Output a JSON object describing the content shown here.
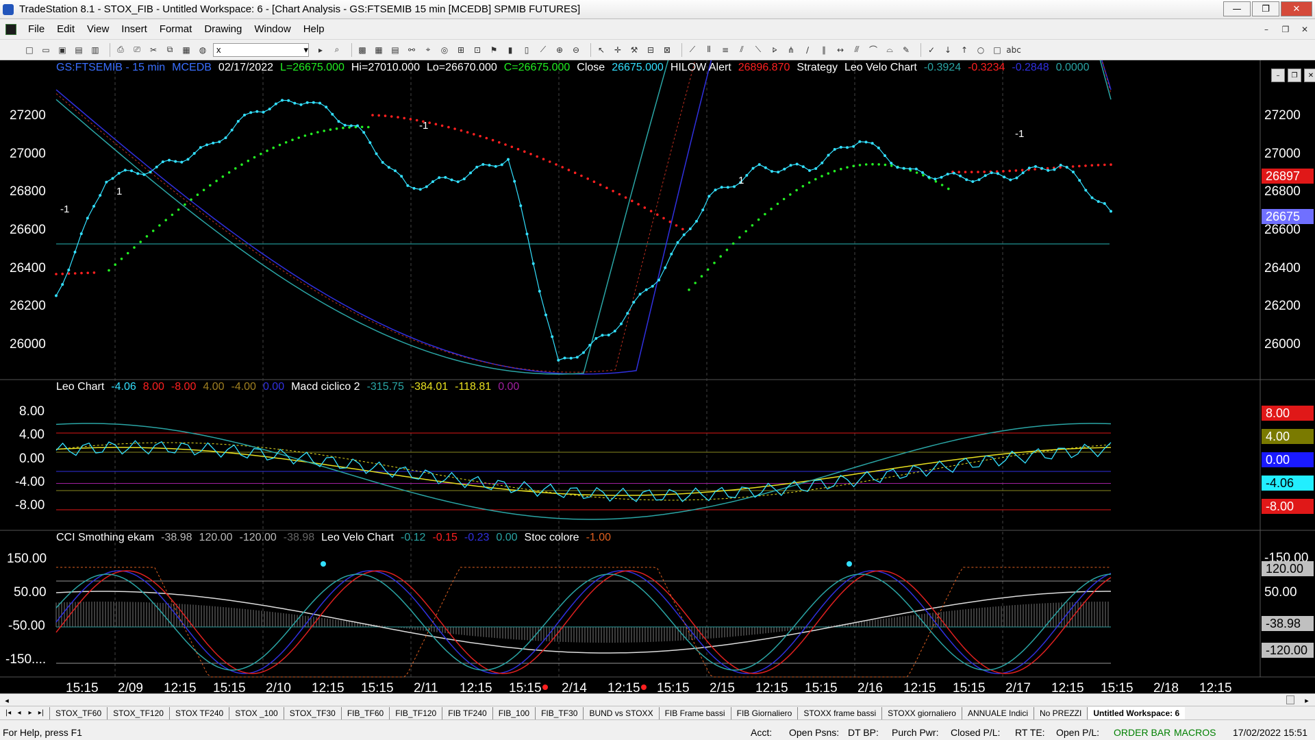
{
  "window": {
    "title": "TradeStation 8.1 - STOX_FIB - Untitled Workspace:  6 - [Chart Analysis - GS:FTSEMIB  15 min  [MCEDB] SPMIB FUTURES]",
    "minimize": "—",
    "maximize": "❐",
    "close": "✕"
  },
  "menu": [
    "File",
    "Edit",
    "View",
    "Insert",
    "Format",
    "Drawing",
    "Window",
    "Help"
  ],
  "toolbar": {
    "symbol_value": "x"
  },
  "panel_buttons": [
    "–",
    "❐",
    "✕"
  ],
  "header1": {
    "symbol": "GS:FTSEMIB - 15 min",
    "source": "MCEDB",
    "date": "02/17/2022",
    "low_label": "L=26675.000",
    "hi": "Hi=27010.000",
    "lo": "Lo=26670.000",
    "c": "C=26675.000",
    "close_label": "Close",
    "close_value": "26675.000",
    "hilow_label": "HILOW Alert",
    "hilow_value": "26896.870",
    "strategy": "Strategy",
    "velo_label": "Leo Velo Chart",
    "velo_values": [
      "-0.3924",
      "-0.3234",
      "-0.2848",
      "0.0000"
    ]
  },
  "header2": {
    "leo_label": "Leo Chart",
    "leo_values": [
      "-4.06",
      "8.00",
      "-8.00",
      "4.00",
      "-4.00",
      "0.00"
    ],
    "macd_label": "Macd ciclico 2",
    "macd_values": [
      "-315.75",
      "-384.01",
      "-118.81",
      "0.00"
    ]
  },
  "header3": {
    "cci_label": "CCI Smothing ekam",
    "cci_values": [
      "-38.98",
      "120.00",
      "-120.00",
      "-38.98"
    ],
    "velo_label": "Leo Velo Chart",
    "velo_values": [
      "-0.12",
      "-0.15",
      "-0.23",
      "0.00"
    ],
    "stoc_label": "Stoc colore",
    "stoc_value": "-1.00"
  },
  "yaxis_price": [
    "27200",
    "27000",
    "26800",
    "26600",
    "26400",
    "26200",
    "26000"
  ],
  "yaxis_leo": [
    "8.00",
    "4.00",
    "0.00",
    "-4.00",
    "-8.00"
  ],
  "yaxis_cci": [
    "150.00",
    "50.00",
    "-50.00",
    "-150...."
  ],
  "yaxis_right_price": [
    "27200",
    "27000",
    "26800",
    "26600",
    "26400",
    "26200",
    "26000"
  ],
  "yaxis_right_leo": [],
  "yaxis_right_cci": [
    "-150.00",
    "50.00"
  ],
  "price_tags": {
    "hilow": "26897",
    "last": "26675",
    "leo_red": "8.00",
    "leo_olive": "4.00",
    "leo_blue": "0.00",
    "leo_cyan": "-4.06",
    "leo_red2": "-8.00",
    "cci_120": "120.00",
    "cci_val": "-38.98",
    "cci_m120": "-120.00"
  },
  "signal_labels": [
    "-1",
    "1",
    "-1",
    "1",
    "-1"
  ],
  "xaxis": [
    "15:15",
    "2/09",
    "12:15",
    "15:15",
    "2/10",
    "12:15",
    "15:15",
    "2/11",
    "12:15",
    "15:15",
    "2/14",
    "12:15",
    "15:15",
    "2/15",
    "12:15",
    "15:15",
    "2/16",
    "12:15",
    "15:15",
    "2/17",
    "12:15",
    "15:15",
    "2/18",
    "12:15"
  ],
  "tabs": [
    "STOX_TF60",
    "STOX_TF120",
    "STOX TF240",
    "STOX _100",
    "STOX_TF30",
    "FIB_TF60",
    "FIB_TF120",
    "FIB TF240",
    "FIB_100",
    "FIB_TF30",
    "BUND vs STOXX",
    "FIB Frame bassi",
    "FIB Giornaliero",
    "STOXX frame bassi",
    "STOXX giornaliero",
    "ANNUALE Indici",
    "No PREZZI",
    "Untitled Workspace:  6"
  ],
  "status": {
    "help": "For Help, press F1",
    "acct": "Acct:",
    "open_psns": "Open Psns:",
    "dt_bp": "DT BP:",
    "purch_pwr": "Purch Pwr:",
    "closed_pl": "Closed P/L:",
    "rt_te": "RT TE:",
    "open_pl": "Open P/L:",
    "order_bar": "ORDER BAR",
    "macros": "MACROS",
    "datetime": "17/02/2022 15:51"
  },
  "colors": {
    "background": "#000000",
    "price": "#33e0ff",
    "hilow_red": "#ff2020",
    "hilow_green": "#22ee22",
    "ma_blue": "#3030e0",
    "ma_teal": "#2aa5a5",
    "ma_red_dotted": "#c03020",
    "macd_yellow": "#e8e020"
  },
  "chart_data": {
    "type": "line",
    "title": "GS:FTSEMIB - 15 min",
    "x": [
      "2/08 15:15",
      "2/09",
      "2/09 12:15",
      "2/09 15:15",
      "2/10",
      "2/10 12:15",
      "2/10 15:15",
      "2/11",
      "2/11 12:15",
      "2/11 15:15",
      "2/14",
      "2/14 12:15",
      "2/14 15:15",
      "2/15",
      "2/15 12:15",
      "2/15 15:15",
      "2/16",
      "2/16 12:15",
      "2/16 15:15",
      "2/17",
      "2/17 12:15",
      "2/17 15:15"
    ],
    "series": [
      {
        "values": [
          26250,
          26850,
          26900,
          27000,
          27200,
          27250,
          27100,
          26800,
          26850,
          26950,
          25900,
          26050,
          26350,
          26750,
          26900,
          26900,
          27050,
          26880,
          26850,
          26860,
          26920,
          26680
        ]
      }
    ],
    "ylim": [
      25850,
      27380
    ],
    "panels": [
      {
        "name": "Leo Chart",
        "ylim": [
          -10,
          11
        ]
      },
      {
        "name": "CCI Smothing ekam",
        "ylim": [
          -200,
          230
        ]
      }
    ]
  }
}
